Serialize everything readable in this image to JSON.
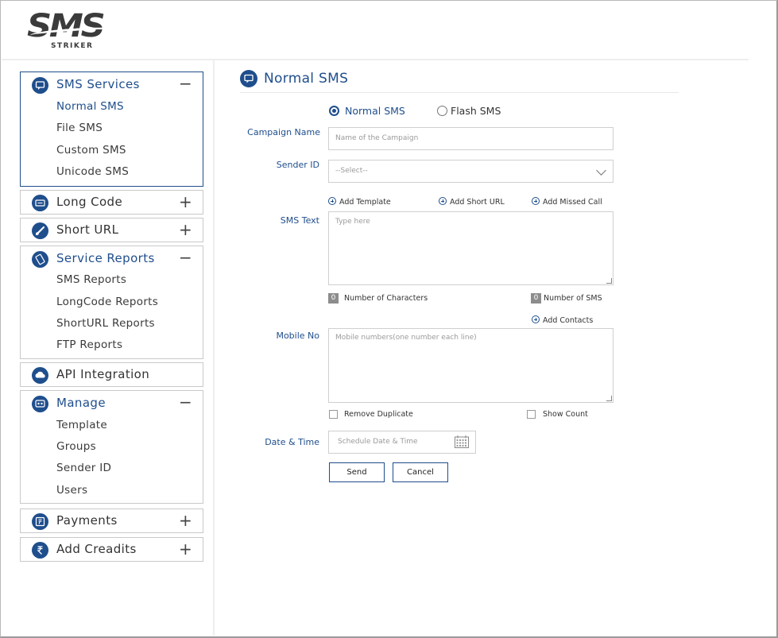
{
  "logo": {
    "main": "SMS",
    "sub": "STRIKER"
  },
  "sidebar": {
    "sms_services": {
      "title": "SMS Services",
      "toggle": "−",
      "items": [
        "Normal SMS",
        "File SMS",
        "Custom SMS",
        "Unicode SMS"
      ]
    },
    "long_code": {
      "title": "Long Code",
      "toggle": "+"
    },
    "short_url": {
      "title": "Short URL",
      "toggle": "+"
    },
    "service_reports": {
      "title": "Service Reports",
      "toggle": "−",
      "items": [
        "SMS Reports",
        "LongCode Reports",
        "ShortURL Reports",
        "FTP Reports"
      ]
    },
    "api_integration": {
      "title": "API Integration"
    },
    "manage": {
      "title": "Manage",
      "toggle": "−",
      "items": [
        "Template",
        "Groups",
        "Sender ID",
        "Users"
      ]
    },
    "payments": {
      "title": "Payments",
      "toggle": "+"
    },
    "add_credits": {
      "title": "Add Creadits",
      "toggle": "+"
    }
  },
  "main": {
    "title": "Normal SMS",
    "sms_type": {
      "options": [
        "Normal SMS",
        "Flash SMS"
      ],
      "selected": "Normal SMS"
    },
    "campaign_name": {
      "label": "Campaign Name",
      "placeholder": "Name of the Campaign"
    },
    "sender_id": {
      "label": "Sender ID",
      "value": "--Select--"
    },
    "links": {
      "add_template": "Add Template",
      "add_short_url": "Add Short URL",
      "add_missed_call": "Add Missed Call",
      "add_contacts": "Add Contacts"
    },
    "sms_text": {
      "label": "SMS Text",
      "placeholder": "Type  here"
    },
    "counters": {
      "chars_value": "0",
      "chars_label": "Number of Characters",
      "sms_value": "0",
      "sms_label": "Number of SMS"
    },
    "mobile_no": {
      "label": "Mobile No",
      "placeholder": "Mobile numbers(one number each line)"
    },
    "options": {
      "remove_duplicate": "Remove Duplicate",
      "show_count": "Show Count"
    },
    "date_time": {
      "label": "Date & Time",
      "placeholder": "Schedule Date & Time"
    },
    "buttons": {
      "send": "Send",
      "cancel": "Cancel"
    }
  },
  "colors": {
    "brand": "#1f4e8c",
    "border": "#c9c9c9"
  }
}
